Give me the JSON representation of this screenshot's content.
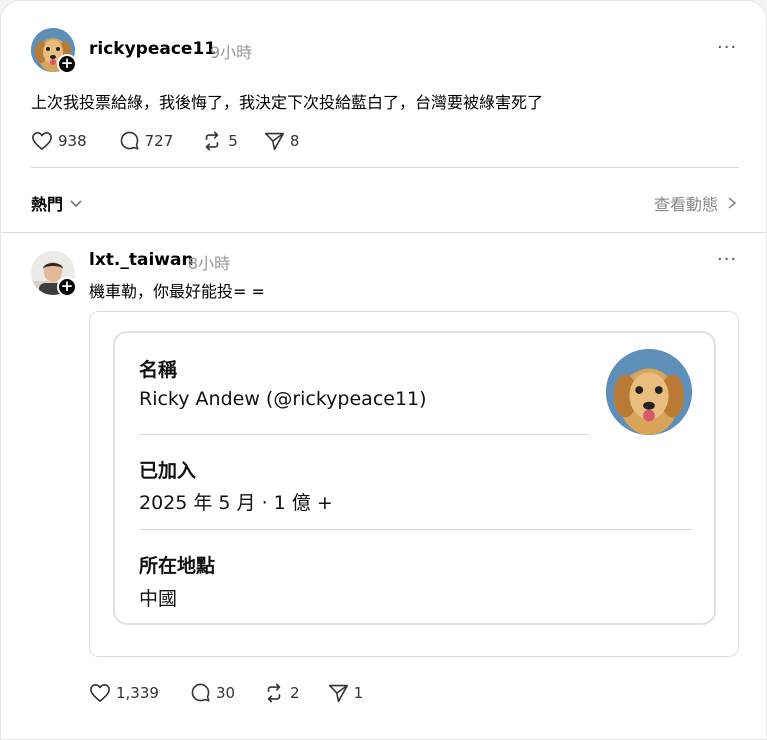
{
  "post": {
    "username": "rickypeace11",
    "time": "9小時",
    "text": "上次我投票給綠，我後悔了，我決定下次投給藍白了，台灣要被綠害死了",
    "likes": "938",
    "comments": "727",
    "reposts": "5",
    "shares": "8"
  },
  "sort_bar": {
    "label": "熱門",
    "view_activity": "查看動態"
  },
  "reply": {
    "username": "lxt._taiwan",
    "time": "8小時",
    "text": "機車勒，你最好能投= =",
    "likes": "1,339",
    "comments": "30",
    "reposts": "2",
    "shares": "1"
  },
  "profile_card": {
    "name_label": "名稱",
    "name_value": "Ricky Andew (@rickypeace11)",
    "joined_label": "已加入",
    "joined_value": "2025 年 5 月 · 1 億 +",
    "location_label": "所在地點",
    "location_value": "中國"
  },
  "colors": {
    "background": "#ffffff",
    "muted_text": "#999999",
    "divider": "#dcdcdc"
  }
}
